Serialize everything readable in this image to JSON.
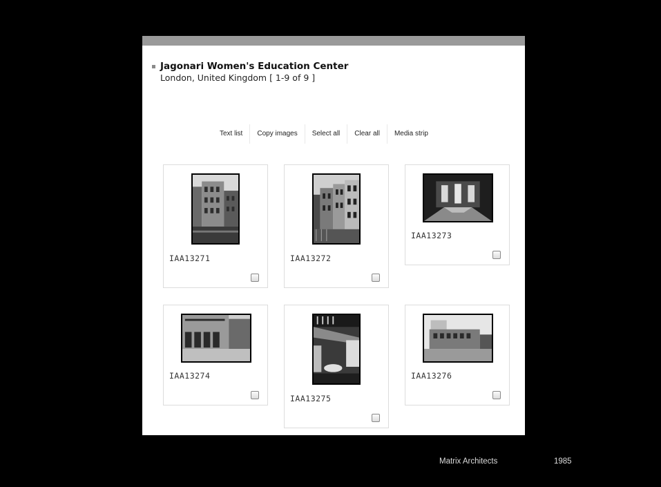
{
  "header": {
    "title": "Jagonari Women's Education Center",
    "subtitle": "London, United Kingdom [ 1-9 of 9 ]"
  },
  "toolbar": {
    "text_list": "Text list",
    "copy_images": "Copy images",
    "select_all": "Select all",
    "clear_all": "Clear all",
    "media_strip": "Media strip"
  },
  "cards": [
    {
      "id": "IAA13271",
      "checked": false
    },
    {
      "id": "IAA13272",
      "checked": false
    },
    {
      "id": "IAA13273",
      "checked": false
    },
    {
      "id": "IAA13274",
      "checked": false
    },
    {
      "id": "IAA13275",
      "checked": false
    },
    {
      "id": "IAA13276",
      "checked": false
    }
  ],
  "footer": {
    "credit": "Matrix Architects",
    "year": "1985"
  }
}
